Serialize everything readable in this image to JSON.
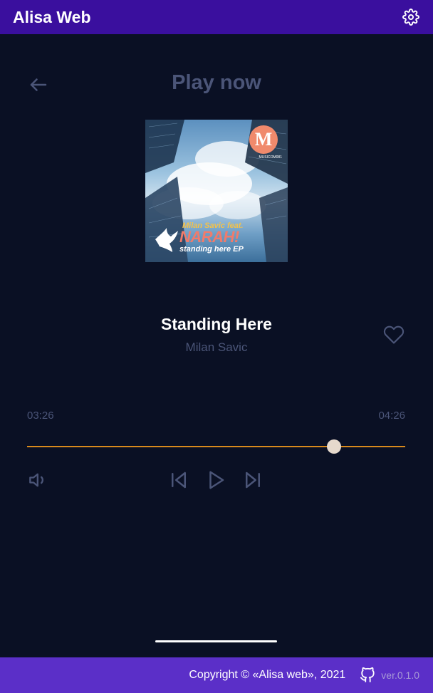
{
  "header": {
    "app_title": "Alisa Web",
    "settings_icon": "gear-icon"
  },
  "screen": {
    "title": "Play now",
    "back_icon": "arrow-left-icon"
  },
  "album_cover": {
    "artist_text": "Milan Savic feat.",
    "feat_text": "NARAH!",
    "ep_text": "standing here EP",
    "logo_letter": "M",
    "label_code": "MUSICOM081"
  },
  "track": {
    "title": "Standing Here",
    "artist": "Milan Savic",
    "favorite_icon": "heart-outline-icon"
  },
  "progress": {
    "current_time": "03:26",
    "total_time": "04:26",
    "fraction": 0.812,
    "accent": "#d98a1c"
  },
  "controls": {
    "volume_icon": "volume-icon",
    "prev_icon": "skip-back-icon",
    "play_icon": "play-icon",
    "next_icon": "skip-forward-icon"
  },
  "footer": {
    "copyright": "Copyright © «Alisa web», 2021",
    "github_icon": "github-icon",
    "version": "ver.0.1.0"
  },
  "colors": {
    "header_bg": "#3a0f9e",
    "page_bg": "#0a1024",
    "footer_bg": "#5b2fc8",
    "muted_text": "#4b5578"
  }
}
